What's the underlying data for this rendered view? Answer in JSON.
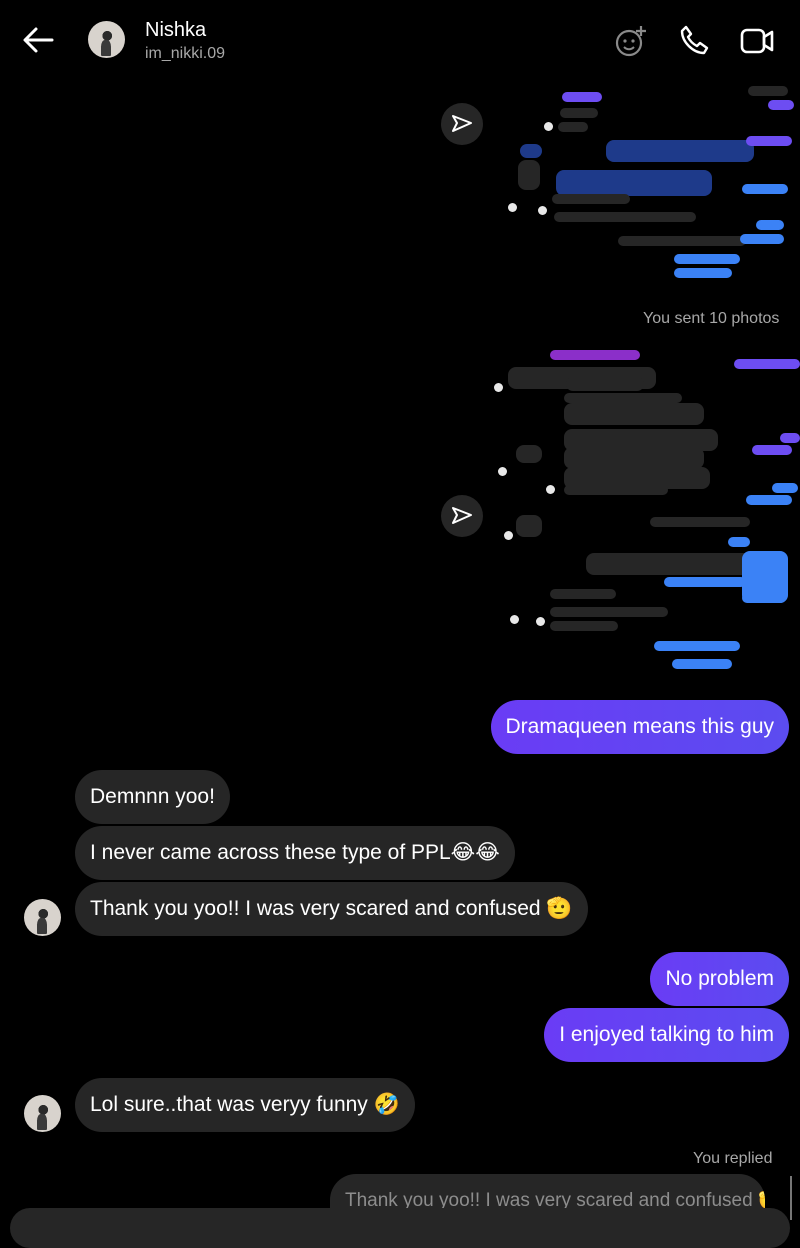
{
  "header": {
    "name": "Nishka",
    "handle": "im_nikki.09",
    "icons": [
      "back-icon",
      "add-emoji-icon",
      "phone-icon",
      "video-icon"
    ]
  },
  "photo_groups": [
    {
      "caption": ""
    },
    {
      "caption": "You sent 10 photos"
    }
  ],
  "messages": [
    {
      "side": "out",
      "text": "Dramaqueen means this guy"
    },
    {
      "side": "in",
      "text": "Demnnn yoo!"
    },
    {
      "side": "in",
      "text": "I never came across these type of PPL😂😂"
    },
    {
      "side": "in",
      "text": "Thank you yoo!! I was very scared and confused 🫡"
    },
    {
      "side": "out",
      "text": "No problem"
    },
    {
      "side": "out",
      "text": "I enjoyed talking to him"
    },
    {
      "side": "in",
      "text": "Lol sure..that was veryy funny 🤣"
    }
  ],
  "reply": {
    "label": "You replied",
    "quoted": "Thank you yoo!! I was very scared and confused 🫡"
  },
  "colors": {
    "accent": "#6a3cf5",
    "incoming": "#262626",
    "muted": "#a8a8a8"
  }
}
